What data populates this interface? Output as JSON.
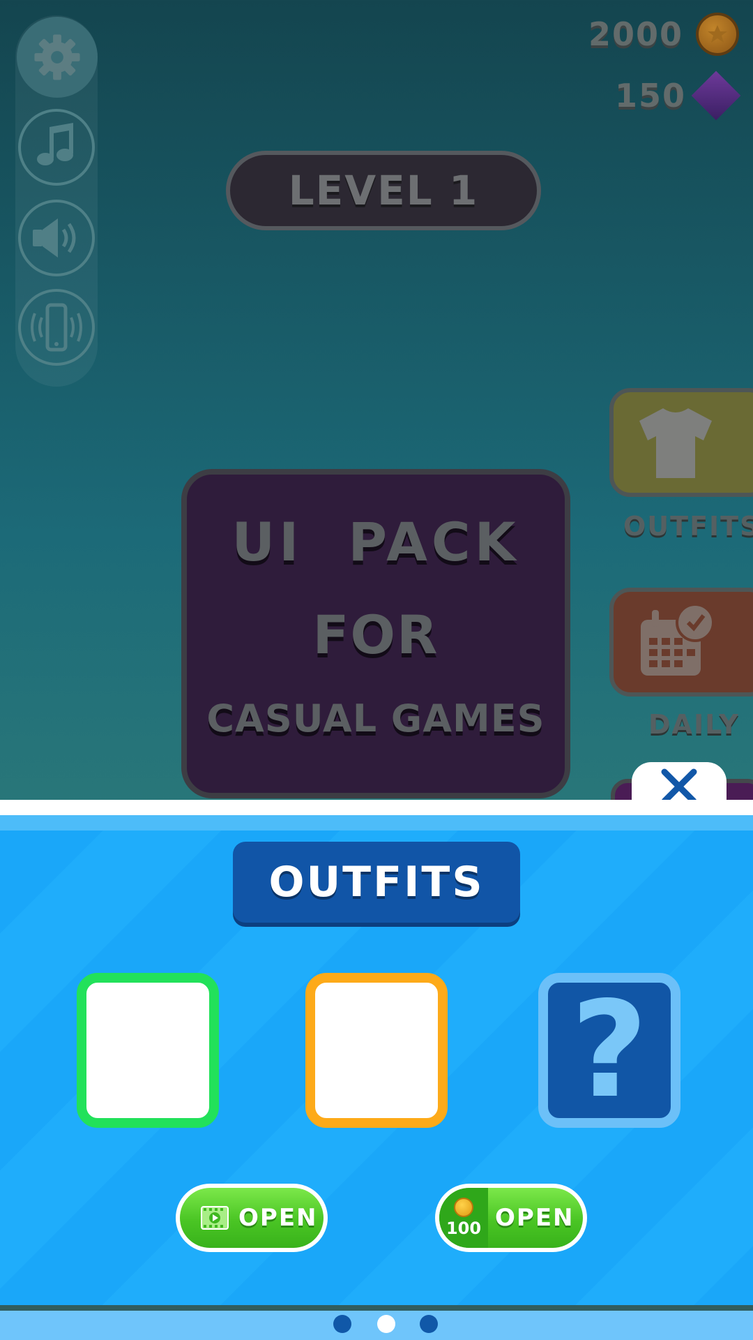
{
  "hud": {
    "coins": "2000",
    "gems": "150",
    "settings": {
      "buttons": [
        "gear-icon",
        "music-icon",
        "sound-icon",
        "vibration-icon"
      ]
    }
  },
  "level": {
    "label": "LEVEL 1"
  },
  "promo": {
    "line1": "UI  PACK",
    "line2": "FOR",
    "line3": "CASUAL GAMES"
  },
  "side_menu": {
    "outfits_label": "OUTFITS",
    "daily_label": "DAILY"
  },
  "panel": {
    "title": "OUTFITS",
    "slots": [
      {
        "frame": "green",
        "content": ""
      },
      {
        "frame": "orange",
        "content": ""
      },
      {
        "frame": "blue",
        "content": "?"
      }
    ],
    "video_button": {
      "label": "OPEN",
      "icon": "video-ad-icon"
    },
    "coin_button": {
      "label": "OPEN",
      "price": "100",
      "icon": "coin-icon"
    },
    "pagination": {
      "count": 3,
      "active_index": 1
    }
  },
  "colors": {
    "panel_blue": "#1aa7f9",
    "title_blue": "#1155a7",
    "slot_green": "#22e15a",
    "slot_orange": "#fdaa19",
    "open_green": "#4ac524"
  }
}
